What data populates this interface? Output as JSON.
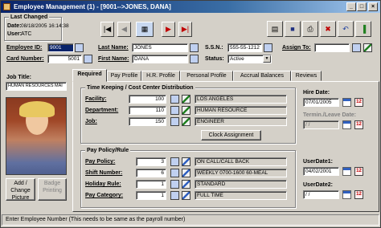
{
  "window": {
    "title": "Employee Management (1) - [9001-->JONES, DANA]"
  },
  "last_changed": {
    "title": "Last Changed",
    "date_label": "Date:",
    "date_value": "08/18/2005 16:14:38",
    "user_label": "User:",
    "user_value": "ATC"
  },
  "header": {
    "employee_id_label": "Employee ID:",
    "employee_id": "9001",
    "card_number_label": "Card Number:",
    "card_number": "5001",
    "last_name_label": "Last Name:",
    "last_name": "JONES",
    "first_name_label": "First Name:",
    "first_name": "DANA",
    "ssn_label": "S.S.N.:",
    "ssn": "555-55-1212",
    "status_label": "Status:",
    "status": "Active",
    "assign_to_label": "Assign To:",
    "assign_to": "",
    "job_title_label": "Job Title:",
    "job_title": "HUMAN RESOURCES MAI"
  },
  "photo_buttons": {
    "add_change": "Add / Change Picture",
    "badge_printing": "Badge Printing"
  },
  "tabs": [
    "Required",
    "Pay Profile",
    "H.R. Profile",
    "Personal Profile",
    "Accrual Balances",
    "Reviews"
  ],
  "timekeeping": {
    "title": "Time Keeping / Cost Center Distribution",
    "rows": [
      {
        "label": "Facility:",
        "code": "100",
        "desc": "LOS ANGELES"
      },
      {
        "label": "Department:",
        "code": "110",
        "desc": "HUMAN RESOURCE"
      },
      {
        "label": "Job:",
        "code": "150",
        "desc": "ENGINEER"
      }
    ],
    "clock_button": "Clock Assignment"
  },
  "pay_policy": {
    "title": "Pay Policy/Rule",
    "rows": [
      {
        "label": "Pay Policy:",
        "code": "3",
        "desc": "ON CALL/CALL BACK"
      },
      {
        "label": "Shift Number:",
        "code": "6",
        "desc": "WEEKLY 0700-1600 60-MEAL"
      },
      {
        "label": "Holiday Rule:",
        "code": "1",
        "desc": "STANDARD"
      },
      {
        "label": "Pay Category:",
        "code": "1",
        "desc": "FULL TIME"
      }
    ]
  },
  "dates": {
    "hire_label": "Hire Date:",
    "hire_value": "07/01/2005",
    "term_label": "Termin./Leave Date:",
    "term_value": "/ /",
    "userdate1_label": "UserDate1:",
    "userdate1_value": "04/02/2001",
    "userdate2_label": "UserDate2:",
    "userdate2_value": "/ /",
    "cal_text": "12"
  },
  "statusbar": {
    "text": "Enter Employee Number (This needs to be same as the payroll number)"
  }
}
